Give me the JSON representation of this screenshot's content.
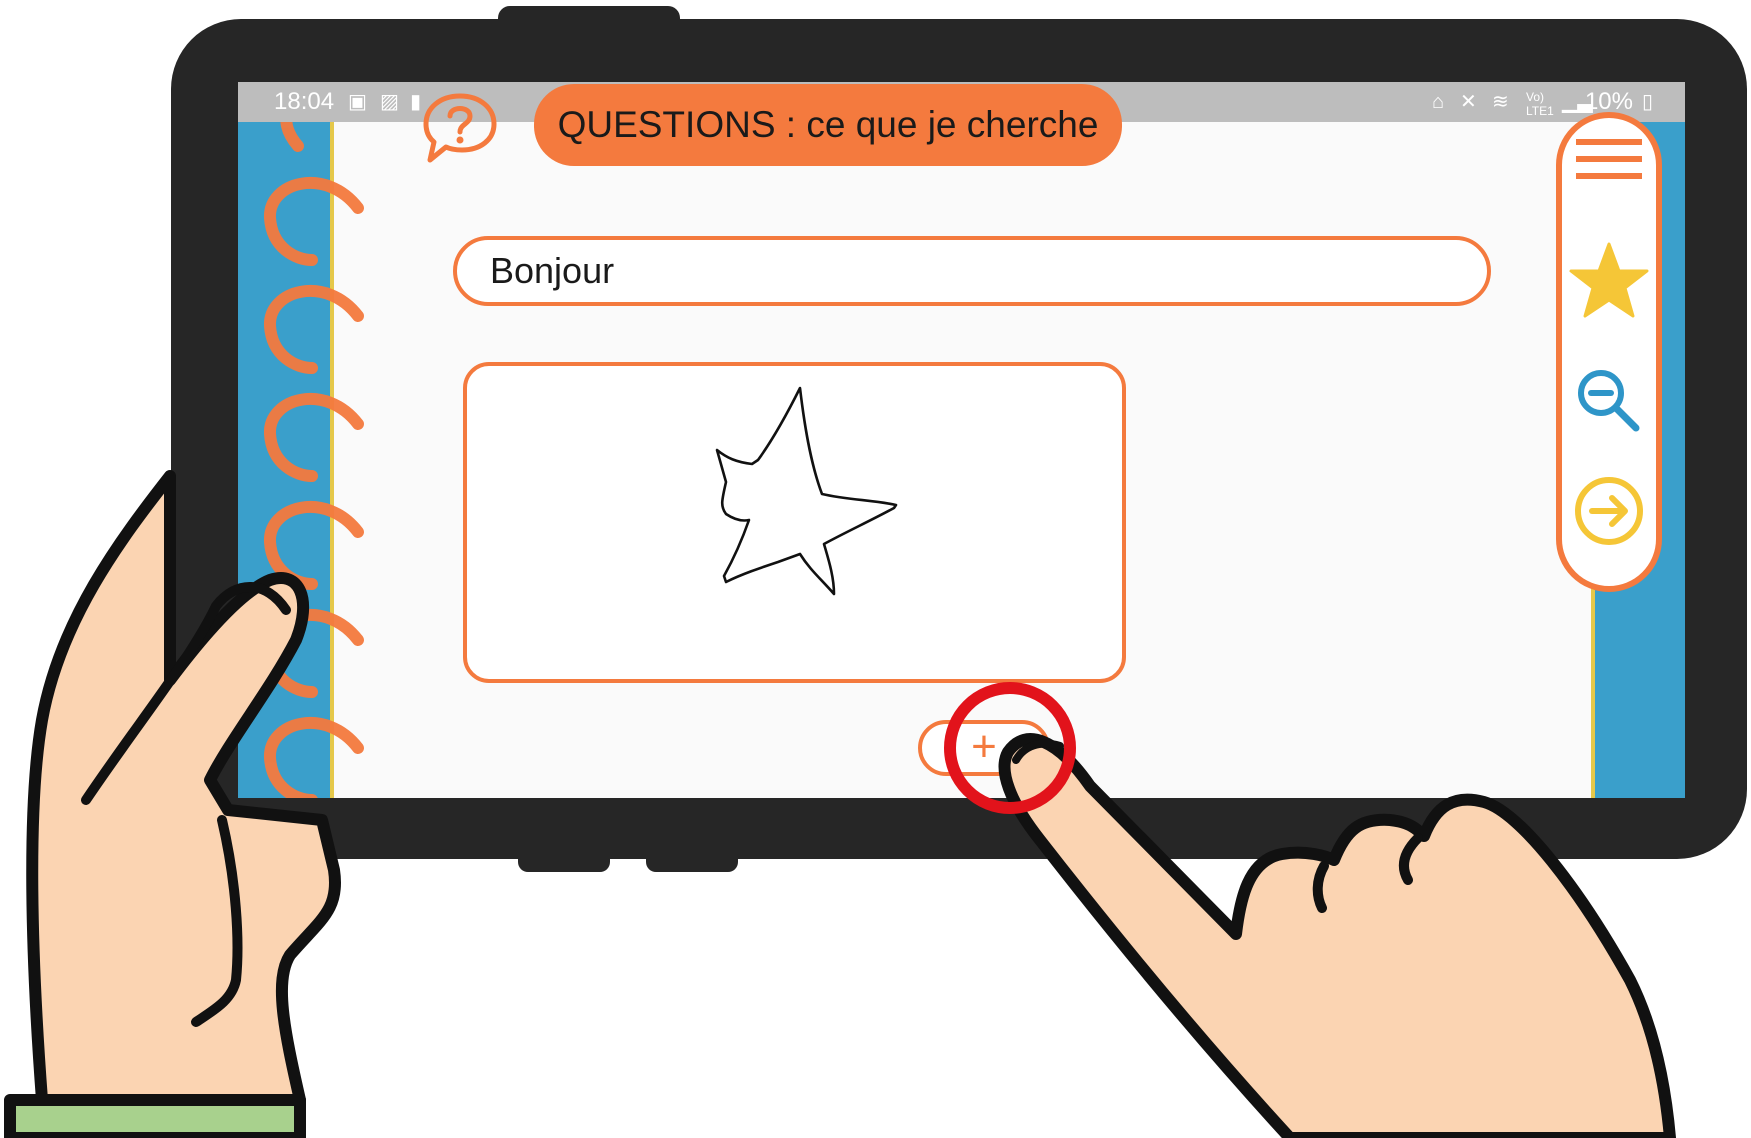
{
  "status_bar": {
    "time": "18:04",
    "battery": "10%",
    "icons": [
      "photo-icon",
      "image-icon",
      "battery-saver-icon",
      "home-lock-icon",
      "mute-icon",
      "wifi-icon",
      "volte-lte-icon",
      "signal-icon",
      "battery-icon"
    ]
  },
  "header": {
    "title": "QUESTIONS : ce que je cherche",
    "help_icon": "question-speech-bubble-icon"
  },
  "word_field": {
    "value": "Bonjour"
  },
  "drawing": {
    "subject": "star-drawing"
  },
  "add_button": {
    "label": "+"
  },
  "toolbar": {
    "items": [
      {
        "icon": "menu-icon",
        "color": "#f47a3e"
      },
      {
        "icon": "star-icon",
        "color": "#f5c637"
      },
      {
        "icon": "zoom-out-icon",
        "color": "#2e95c8"
      },
      {
        "icon": "next-arrow-icon",
        "color": "#f5c637"
      }
    ]
  },
  "colors": {
    "accent": "#f47a3e",
    "binder_blue": "#3a9fcb",
    "page": "#fafafa",
    "gold": "#f5c637",
    "tap_marker": "#e2131b",
    "tablet": "#262626",
    "skin": "#fbd4b2",
    "sleeve": "#a8d18d"
  }
}
